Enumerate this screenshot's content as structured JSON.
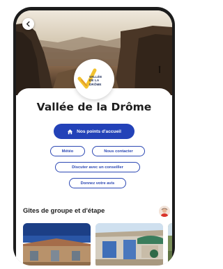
{
  "destination": {
    "logo_text": [
      "VALLÉE",
      "DE LA DRÔME"
    ],
    "title": "Vallée de la Drôme"
  },
  "actions": {
    "primary_label": "Nos points d'accueil",
    "chips": [
      "Météo",
      "Nous contacter",
      "Discuter avec un conseiller",
      "Donnez votre avis"
    ]
  },
  "section": {
    "title": "Gîtes de groupe et d'étape"
  },
  "colors": {
    "primary_blue": "#2342b8",
    "chip_border": "#2b47b3",
    "title_text": "#1d1d1d",
    "logo_yellow": "#f2c230"
  },
  "icons": {
    "back": "arrow-left-icon",
    "primary": "home-icon",
    "avatar": "advisor-avatar-icon"
  }
}
